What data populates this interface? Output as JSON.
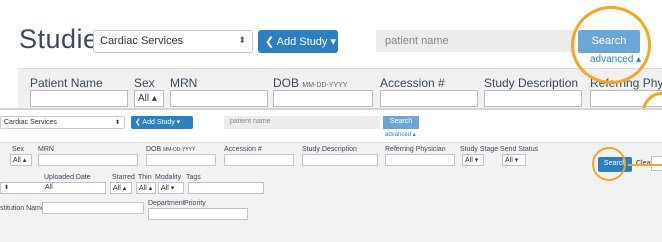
{
  "top": {
    "title": "Studies",
    "service_select": "Cardiac Services",
    "add_study": "❮ Add Study ▾",
    "search_placeholder": "patient name",
    "search_button": "Search",
    "advanced_link": "advanced ▴",
    "columns": {
      "patient_name": "Patient Name",
      "sex": "Sex",
      "sex_value": "All ▴",
      "mrn": "MRN",
      "dob": "DOB",
      "dob_format": "MM-DD-YYYY",
      "accession": "Accession #",
      "study_description": "Study Description",
      "referring_physician": "Referring Physicia"
    }
  },
  "bottom": {
    "service_select": "Cardiac Services",
    "add_study": "❮ Add Study ▾",
    "search_placeholder": "patient name",
    "search_button": "Search",
    "advanced_link": "advanced ▴",
    "columns": {
      "sex": "Sex",
      "sex_value": "All ▴",
      "mrn": "MRN",
      "dob": "DOB",
      "dob_format": "MM-DD-YYYY",
      "accession": "Accession #",
      "study_description": "Study Description",
      "referring_physician": "Referring Physician",
      "study_stage": "Study Stage",
      "send_status": "Send Status",
      "study_stage_value": "All ▾",
      "send_status_value": "All ▾"
    },
    "row2": {
      "uploaded_date": "Uploaded Date",
      "uploaded_value": "All",
      "starred": "Starred",
      "starred_value": "All ▴",
      "thin": "Thin",
      "thin_value": "All ▴",
      "modality": "Modality",
      "modality_value": "All ▾",
      "tags": "Tags"
    },
    "row3": {
      "institution_name": "stitution Name",
      "department": "Department",
      "priority": "Priority"
    },
    "search_button_2": "Search",
    "clear_label": "Clear"
  },
  "accent_colors": {
    "primary_blue": "#2d7fc4",
    "light_blue": "#6aa7d7",
    "highlight_orange": "#f5a623"
  }
}
